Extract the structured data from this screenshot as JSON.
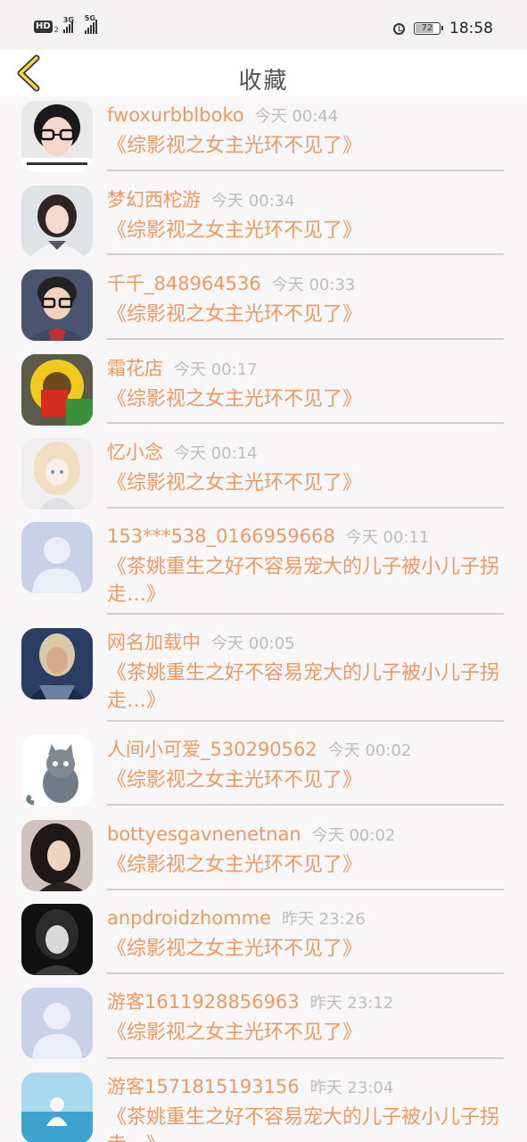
{
  "status_bar": {
    "hd": "HD",
    "hd_sub": "2",
    "net1": "3G",
    "net2": "5G",
    "battery": "72",
    "time": "18:58"
  },
  "header": {
    "title": "收藏"
  },
  "items": [
    {
      "user": "fwoxurbblboko",
      "time": "今天 00:44",
      "novel": "《综影视之女主光环不见了》",
      "avatar": "girl-glasses"
    },
    {
      "user": "梦幻西柁游",
      "time": "今天 00:34",
      "novel": "《综影视之女主光环不见了》",
      "avatar": "girl-portrait"
    },
    {
      "user": "千千_848964536",
      "time": "今天 00:33",
      "novel": "《综影视之女主光环不见了》",
      "avatar": "boy-glasses"
    },
    {
      "user": "霜花店",
      "time": "今天 00:17",
      "novel": "《综影视之女主光环不见了》",
      "avatar": "yellow-toy"
    },
    {
      "user": "忆小念",
      "time": "今天 00:14",
      "novel": "《综影视之女主光环不见了》",
      "avatar": "anime-girl"
    },
    {
      "user": "153***538_0166959668",
      "time": "今天 00:11",
      "novel": "《茶姚重生之好不容易宠大的儿子被小儿子拐走…》",
      "avatar": "default"
    },
    {
      "user": "网名加载中",
      "time": "今天 00:05",
      "novel": "《茶姚重生之好不容易宠大的儿子被小儿子拐走…》",
      "avatar": "game-warrior"
    },
    {
      "user": "人间小可爱_530290562",
      "time": "今天 00:02",
      "novel": "《综影视之女主光环不见了》",
      "avatar": "cat-cartoon"
    },
    {
      "user": "bottyesgavnenetnan",
      "time": "今天 00:02",
      "novel": "《综影视之女主光环不见了》",
      "avatar": "woman-dark"
    },
    {
      "user": "anpdroidzhomme",
      "time": "昨天 23:26",
      "novel": "《综影视之女主光环不见了》",
      "avatar": "bw-girl"
    },
    {
      "user": "游客1611928856963",
      "time": "昨天 23:12",
      "novel": "《综影视之女主光环不见了》",
      "avatar": "default"
    },
    {
      "user": "游客1571815193156",
      "time": "昨天 23:04",
      "novel": "《茶姚重生之好不容易宠大的儿子被小儿子拐走…》",
      "avatar": "sea-girl"
    }
  ]
}
